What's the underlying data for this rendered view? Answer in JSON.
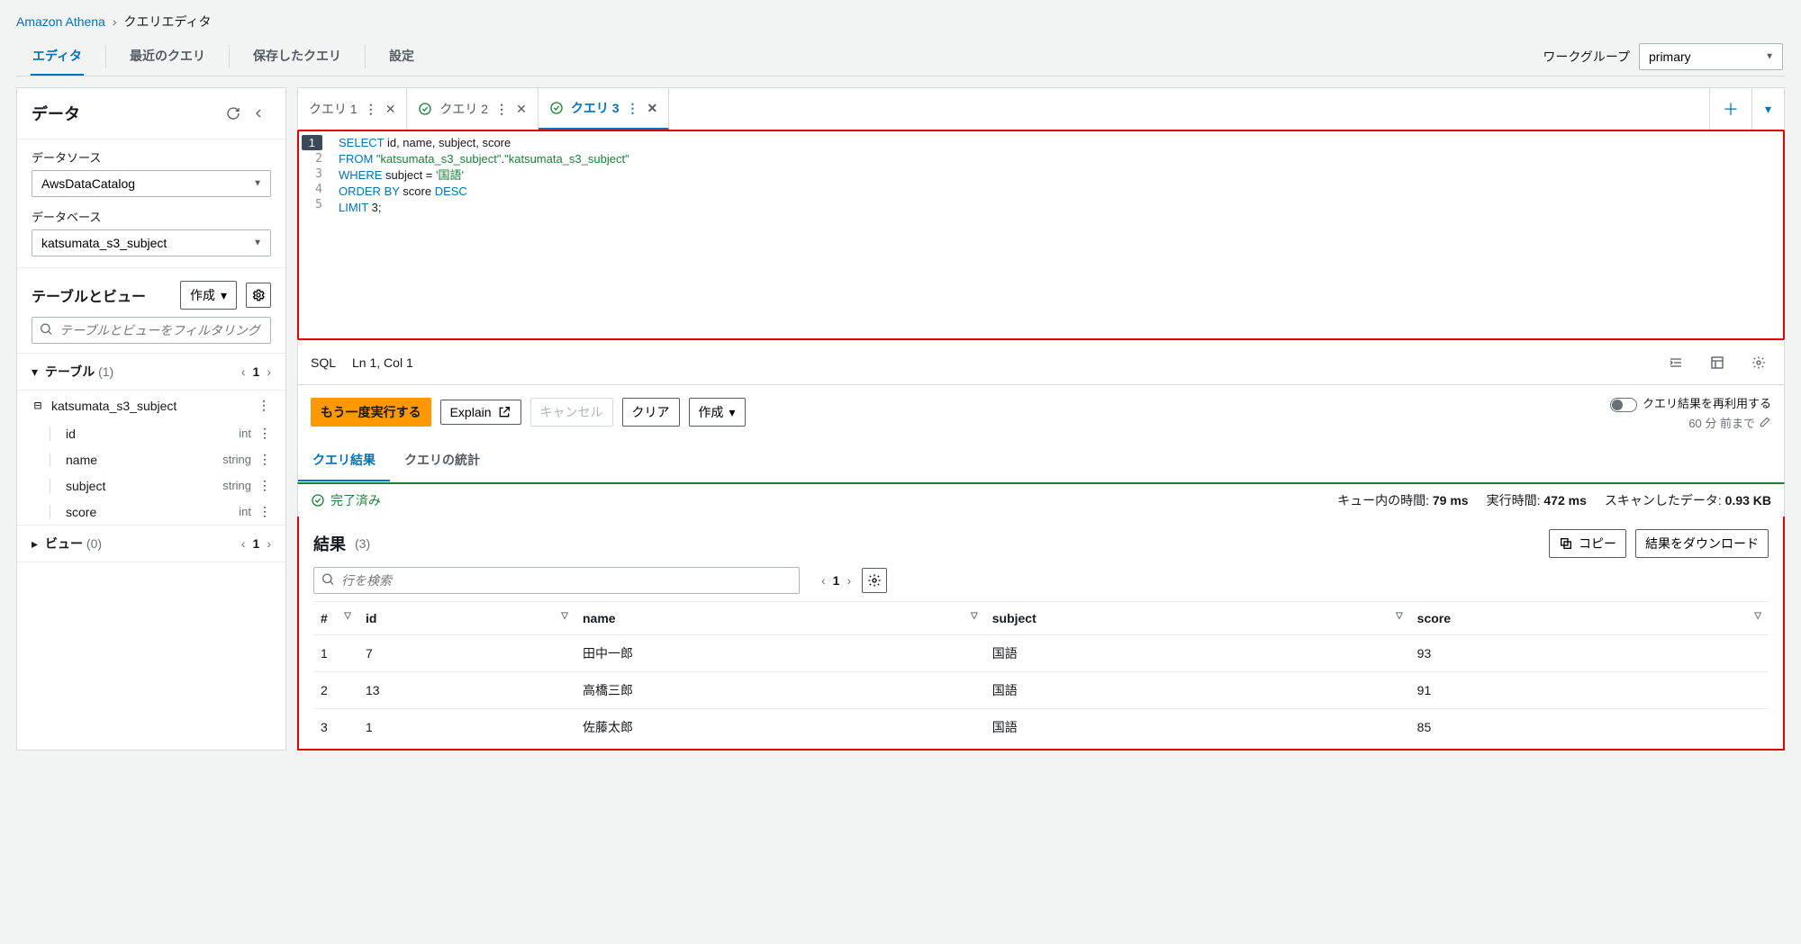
{
  "breadcrumb": {
    "service": "Amazon Athena",
    "page": "クエリエディタ"
  },
  "topTabs": {
    "editor": "エディタ",
    "recent": "最近のクエリ",
    "saved": "保存したクエリ",
    "settings": "設定"
  },
  "workgroup": {
    "label": "ワークグループ",
    "value": "primary"
  },
  "sidebar": {
    "title": "データ",
    "dataSource": {
      "label": "データソース",
      "value": "AwsDataCatalog"
    },
    "database": {
      "label": "データベース",
      "value": "katsumata_s3_subject"
    },
    "tv": {
      "title": "テーブルとビュー",
      "createBtn": "作成",
      "filterPlaceholder": "テーブルとビューをフィルタリング"
    },
    "tablesHeader": {
      "label": "テーブル",
      "count": "(1)",
      "page": "1"
    },
    "table": {
      "name": "katsumata_s3_subject",
      "columns": [
        {
          "name": "id",
          "type": "int"
        },
        {
          "name": "name",
          "type": "string"
        },
        {
          "name": "subject",
          "type": "string"
        },
        {
          "name": "score",
          "type": "int"
        }
      ]
    },
    "viewsHeader": {
      "label": "ビュー",
      "count": "(0)",
      "page": "1"
    }
  },
  "queryTabs": {
    "t1": "クエリ 1",
    "t2": "クエリ 2",
    "t3": "クエリ 3"
  },
  "sql": {
    "l1a": "SELECT",
    "l1b": " id, name, subject, score",
    "l2a": "FROM ",
    "l2b": "\"katsumata_s3_subject\"",
    "l2c": ".",
    "l2d": "\"katsumata_s3_subject\"",
    "l3a": "WHERE",
    "l3b": " subject = ",
    "l3c": "'国語'",
    "l4a": "ORDER",
    "l4b": " BY",
    "l4c": " score ",
    "l4d": "DESC",
    "l5a": "LIMIT",
    "l5b": " 3;"
  },
  "editorStatus": {
    "lang": "SQL",
    "pos": "Ln 1, Col 1"
  },
  "actions": {
    "runAgain": "もう一度実行する",
    "explain": "Explain",
    "cancel": "キャンセル",
    "clear": "クリア",
    "create": "作成",
    "reuseLabel": "クエリ結果を再利用する",
    "reuseSub": "60 分 前まで"
  },
  "resultTabs": {
    "results": "クエリ結果",
    "stats": "クエリの統計"
  },
  "status": {
    "done": "完了済み",
    "queueLabel": "キュー内の時間:",
    "queueVal": "79 ms",
    "runLabel": "実行時間:",
    "runVal": "472 ms",
    "scanLabel": "スキャンしたデータ:",
    "scanVal": "0.93 KB"
  },
  "results": {
    "title": "結果",
    "count": "(3)",
    "copy": "コピー",
    "download": "結果をダウンロード",
    "searchPlaceholder": "行を検索",
    "page": "1",
    "columns": {
      "idx": "#",
      "id": "id",
      "name": "name",
      "subject": "subject",
      "score": "score"
    },
    "rows": [
      {
        "idx": "1",
        "id": "7",
        "name": "田中一郎",
        "subject": "国語",
        "score": "93"
      },
      {
        "idx": "2",
        "id": "13",
        "name": "高橋三郎",
        "subject": "国語",
        "score": "91"
      },
      {
        "idx": "3",
        "id": "1",
        "name": "佐藤太郎",
        "subject": "国語",
        "score": "85"
      }
    ]
  }
}
